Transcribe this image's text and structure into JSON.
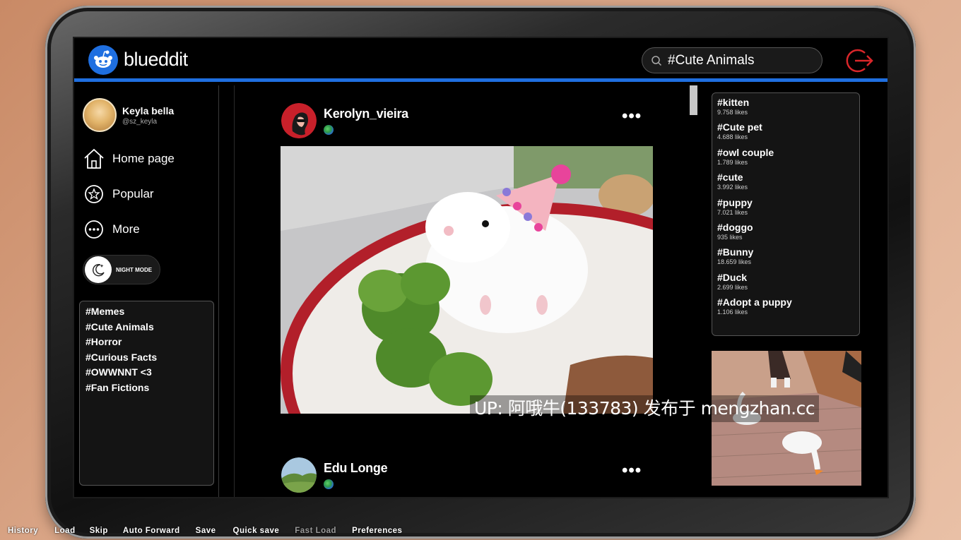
{
  "app": {
    "name": "blueddit"
  },
  "search": {
    "value": "#Cute Animals"
  },
  "user": {
    "name": "Keyla bella",
    "handle": "@sz_keyla"
  },
  "nav": [
    {
      "label": "Home page",
      "icon": "home-icon"
    },
    {
      "label": "Popular",
      "icon": "star-icon"
    },
    {
      "label": "More",
      "icon": "more-icon"
    }
  ],
  "night_mode": {
    "label": "NIGHT MODE"
  },
  "communities": [
    "#Memes",
    "#Cute Animals",
    "#Horror",
    "#Curious Facts",
    "#OWWNNT <3",
    "#Fan Fictions"
  ],
  "posts": [
    {
      "user": "Kerolyn_vieira",
      "image": "hamster-birthday-photo"
    },
    {
      "user": "Edu Longe",
      "image": "landscape-avatar"
    }
  ],
  "trending": [
    {
      "tag": "#kitten",
      "likes": "9.758 likes"
    },
    {
      "tag": "#Cute pet",
      "likes": "4.688 likes"
    },
    {
      "tag": "#owl couple",
      "likes": "1.789 likes"
    },
    {
      "tag": "#cute",
      "likes": "3.992 likes"
    },
    {
      "tag": "#puppy",
      "likes": "7.021 likes"
    },
    {
      "tag": "#doggo",
      "likes": "935 likes"
    },
    {
      "tag": "#Bunny",
      "likes": "18.659 likes"
    },
    {
      "tag": "#Duck",
      "likes": "2.699 likes"
    },
    {
      "tag": "#Adopt a puppy",
      "likes": "1.106 likes"
    }
  ],
  "watermark": "UP: 阿哦牛(133783) 发布于 mengzhan.cc",
  "quick_menu": [
    {
      "label": "History",
      "enabled": true
    },
    {
      "label": "Load",
      "enabled": true
    },
    {
      "label": "Skip",
      "enabled": true
    },
    {
      "label": "Auto Forward",
      "enabled": true
    },
    {
      "label": "Save",
      "enabled": true
    },
    {
      "label": "Quick save",
      "enabled": true
    },
    {
      "label": "Fast Load",
      "enabled": false
    },
    {
      "label": "Preferences",
      "enabled": true
    }
  ],
  "colors": {
    "accent": "#1f6fe0",
    "logout": "#d9262a",
    "background": "#000000"
  }
}
